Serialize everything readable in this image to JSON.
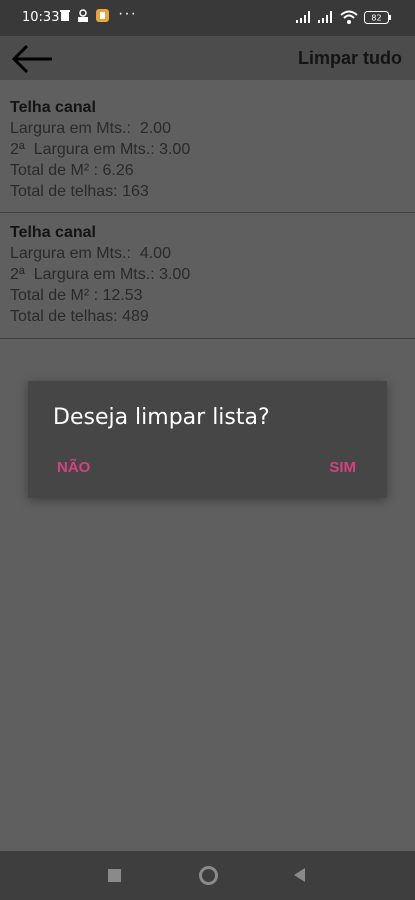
{
  "status_bar": {
    "time": "10:33",
    "more": "···",
    "battery": "82"
  },
  "app_bar": {
    "clear_all_label": "Limpar tudo"
  },
  "list": {
    "items": [
      {
        "title": "Telha canal",
        "line1": "Largura em Mts.:  2.00",
        "line2": "2ª  Largura em Mts.: 3.00",
        "line3": "Total de M² : 6.26",
        "line4": "Total de telhas: 163"
      },
      {
        "title": "Telha canal",
        "line1": "Largura em Mts.:  4.00",
        "line2": "2ª  Largura em Mts.: 3.00",
        "line3": "Total de M² : 12.53",
        "line4": "Total de telhas: 489"
      }
    ]
  },
  "dialog": {
    "title": "Deseja limpar lista?",
    "no_label": "NÃO",
    "yes_label": "SIM"
  }
}
